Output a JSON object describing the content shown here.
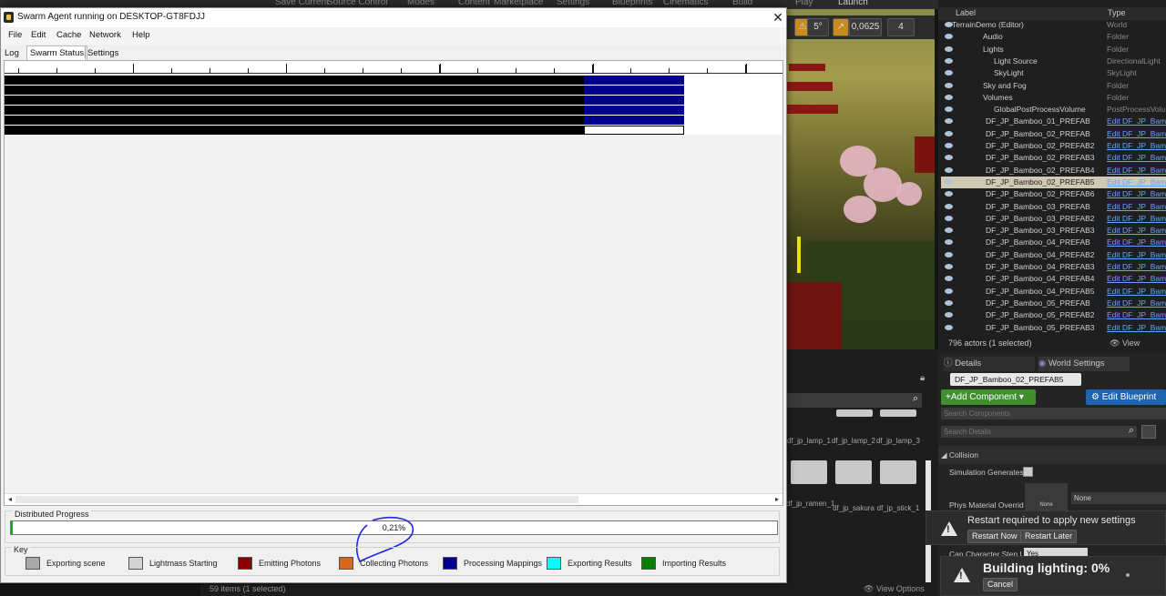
{
  "ue_toolbar": {
    "items": [
      "Save Current",
      "Source Control",
      "Modes",
      "Content",
      "Marketplace",
      "Settings",
      "Blueprints",
      "Cinematics",
      "Build",
      "Play",
      "Launch"
    ]
  },
  "viewport": {
    "angle": "5°",
    "scale": "0,0625",
    "cam_speed": "4"
  },
  "outliner": {
    "col_label": "Label",
    "col_type": "Type",
    "rows": [
      {
        "label": "TerrainDemo (Editor)",
        "type": "World",
        "link": false
      },
      {
        "label": "Audio",
        "type": "Folder",
        "link": false
      },
      {
        "label": "Lights",
        "type": "Folder",
        "link": false
      },
      {
        "label": "Light Source",
        "type": "DirectionalLight",
        "link": false
      },
      {
        "label": "SkyLight",
        "type": "SkyLight",
        "link": false
      },
      {
        "label": "Sky and Fog",
        "type": "Folder",
        "link": false
      },
      {
        "label": "Volumes",
        "type": "Folder",
        "link": false
      },
      {
        "label": "GlobalPostProcessVolume",
        "type": "PostProcessVolu",
        "link": false
      },
      {
        "label": "DF_JP_Bamboo_01_PREFAB",
        "type": "Edit DF_JP_Bam",
        "link": true
      },
      {
        "label": "DF_JP_Bamboo_02_PREFAB",
        "type": "Edit DF_JP_Bam",
        "link": true
      },
      {
        "label": "DF_JP_Bamboo_02_PREFAB2",
        "type": "Edit DF_JP_Bam",
        "link": true
      },
      {
        "label": "DF_JP_Bamboo_02_PREFAB3",
        "type": "Edit DF_JP_Bam",
        "link": true
      },
      {
        "label": "DF_JP_Bamboo_02_PREFAB4",
        "type": "Edit DF_JP_Bam",
        "link": true
      },
      {
        "label": "DF_JP_Bamboo_02_PREFAB5",
        "type": "Edit DF_JP_Bam",
        "link": true,
        "selected": true
      },
      {
        "label": "DF_JP_Bamboo_02_PREFAB6",
        "type": "Edit DF_JP_Bam",
        "link": true
      },
      {
        "label": "DF_JP_Bamboo_03_PREFAB",
        "type": "Edit DF_JP_Bam",
        "link": true
      },
      {
        "label": "DF_JP_Bamboo_03_PREFAB2",
        "type": "Edit DF_JP_Bam",
        "link": true
      },
      {
        "label": "DF_JP_Bamboo_03_PREFAB3",
        "type": "Edit DF_JP_Bam",
        "link": true
      },
      {
        "label": "DF_JP_Bamboo_04_PREFAB",
        "type": "Edit DF_JP_Bam",
        "link": true
      },
      {
        "label": "DF_JP_Bamboo_04_PREFAB2",
        "type": "Edit DF_JP_Bam",
        "link": true
      },
      {
        "label": "DF_JP_Bamboo_04_PREFAB3",
        "type": "Edit DF_JP_Bam",
        "link": true
      },
      {
        "label": "DF_JP_Bamboo_04_PREFAB4",
        "type": "Edit DF_JP_Bam",
        "link": true
      },
      {
        "label": "DF_JP_Bamboo_04_PREFAB5",
        "type": "Edit DF_JP_Bam",
        "link": true
      },
      {
        "label": "DF_JP_Bamboo_05_PREFAB",
        "type": "Edit DF_JP_Bam",
        "link": true
      },
      {
        "label": "DF_JP_Bamboo_05_PREFAB2",
        "type": "Edit DF_JP_Bam",
        "link": true
      },
      {
        "label": "DF_JP_Bamboo_05_PREFAB3",
        "type": "Edit DF_JP_Bam",
        "link": true
      }
    ],
    "footer_count": "796 actors (1 selected)",
    "view_options": "View Options"
  },
  "content_browser": {
    "row1": [
      "df_jp_lamp_1",
      "df_jp_lamp_2",
      "df_jp_lamp_3"
    ],
    "row2": [
      "df_jp_ramen_1",
      "df_jp_sakura",
      "df_jp_stick_1"
    ],
    "status": "59 items (1 selected)",
    "view_options": "View Options"
  },
  "details": {
    "tab_details": "Details",
    "tab_world": "World Settings",
    "object_name": "DF_JP_Bamboo_02_PREFAB5",
    "add_component": "+Add Component ▾",
    "edit_blueprint": "Edit Blueprint",
    "search_components": "Search Components",
    "search_details": "Search Details",
    "section_collision": "Collision",
    "sim_generates": "Simulation Generates",
    "phys_material": "Phys Material Overrid",
    "phys_none_thumb": "None",
    "phys_none_dropdown": "None",
    "can_step_up": "Can Character Step Up",
    "can_step_value": "Yes"
  },
  "notifications": {
    "restart_text": "Restart required to apply new settings",
    "restart_now": "Restart Now",
    "restart_later": "Restart Later",
    "building_text": "Building lighting:  0%",
    "cancel": "Cancel"
  },
  "swarm": {
    "title": "Swarm Agent running on DESKTOP-GT8FDJJ",
    "menu": [
      "File",
      "Edit",
      "Cache",
      "Network",
      "Help"
    ],
    "tabs": [
      "Log",
      "Swarm Status",
      "Settings"
    ],
    "active_tab": "Swarm Status",
    "progress_label": "Distributed Progress",
    "progress_percent_text": "0,21%",
    "progress_fraction": 0.0021,
    "key_label": "Key",
    "key_items": [
      {
        "label": "Exporting scene",
        "color": "#a9a9a9"
      },
      {
        "label": "Lightmass Starting",
        "color": "#d3d3d3"
      },
      {
        "label": "Emitting Photons",
        "color": "#8b0000"
      },
      {
        "label": "Collecting Photons",
        "color": "#d2691e"
      },
      {
        "label": "Processing Mappings",
        "color": "#00008b"
      },
      {
        "label": "Exporting Results",
        "color": "#00ffff"
      },
      {
        "label": "Importing Results",
        "color": "#008000"
      }
    ],
    "timeline": {
      "row_count": 6,
      "black_color": "#000000",
      "blue_color": "#00008b"
    }
  }
}
